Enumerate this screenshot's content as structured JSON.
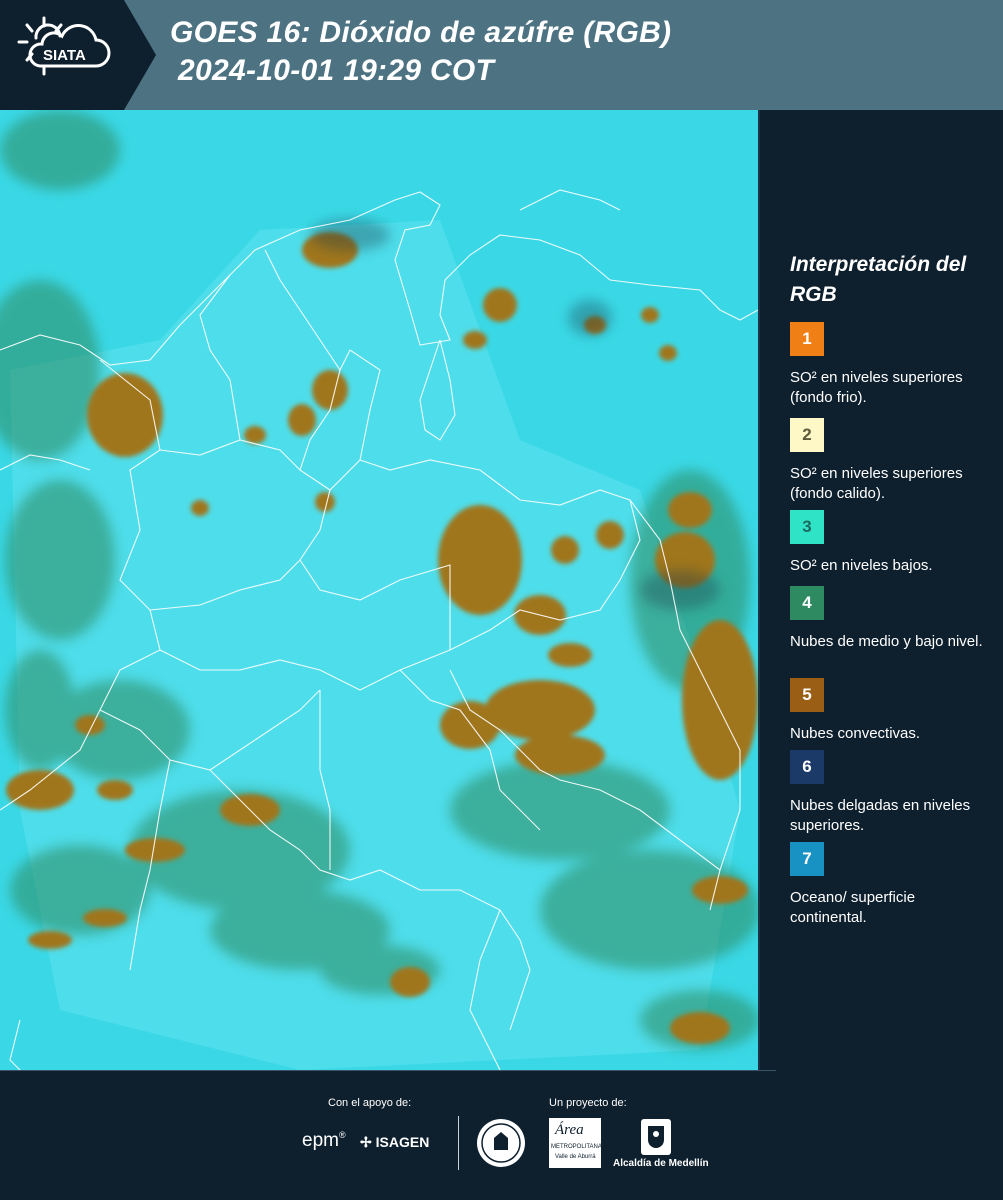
{
  "header": {
    "logo_text": "SIATA",
    "title_line1": "GOES 16: Dióxido de azúfre (RGB)",
    "title_line2": "2024-10-01 19:29 COT"
  },
  "legend": {
    "title": "Interpretación del RGB",
    "items": [
      {
        "number": "1",
        "color": "#f07f15",
        "text_color": "#ffffff",
        "label": "SO² en niveles superiores (fondo frio)."
      },
      {
        "number": "2",
        "color": "#fdf8c6",
        "text_color": "#5d5a3c",
        "label": "SO² en niveles superiores (fondo calido)."
      },
      {
        "number": "3",
        "color": "#2fe4c6",
        "text_color": "#1d6b60",
        "label": "SO² en niveles bajos."
      },
      {
        "number": "4",
        "color": "#2e8a60",
        "text_color": "#ffffff",
        "label": "Nubes de medio y bajo nivel."
      },
      {
        "number": "5",
        "color": "#9a5f14",
        "text_color": "#ffffff",
        "label": "Nubes convectivas."
      },
      {
        "number": "6",
        "color": "#1c3a68",
        "text_color": "#ffffff",
        "label": "Nubes delgadas en niveles superiores."
      },
      {
        "number": "7",
        "color": "#1792c2",
        "text_color": "#ffffff",
        "label": "Oceano/ superficie continental."
      }
    ]
  },
  "footer": {
    "support_label": "Con el apoyo de:",
    "project_label": "Un proyecto de:",
    "sponsor_epm": "epm",
    "sponsor_isagen": "ISAGEN",
    "partner_area_1": "Área",
    "partner_area_2": "METROPOLITANA",
    "partner_area_3": "Valle de Aburrá",
    "partner_alcaldia": "Alcaldía de Medellín"
  }
}
